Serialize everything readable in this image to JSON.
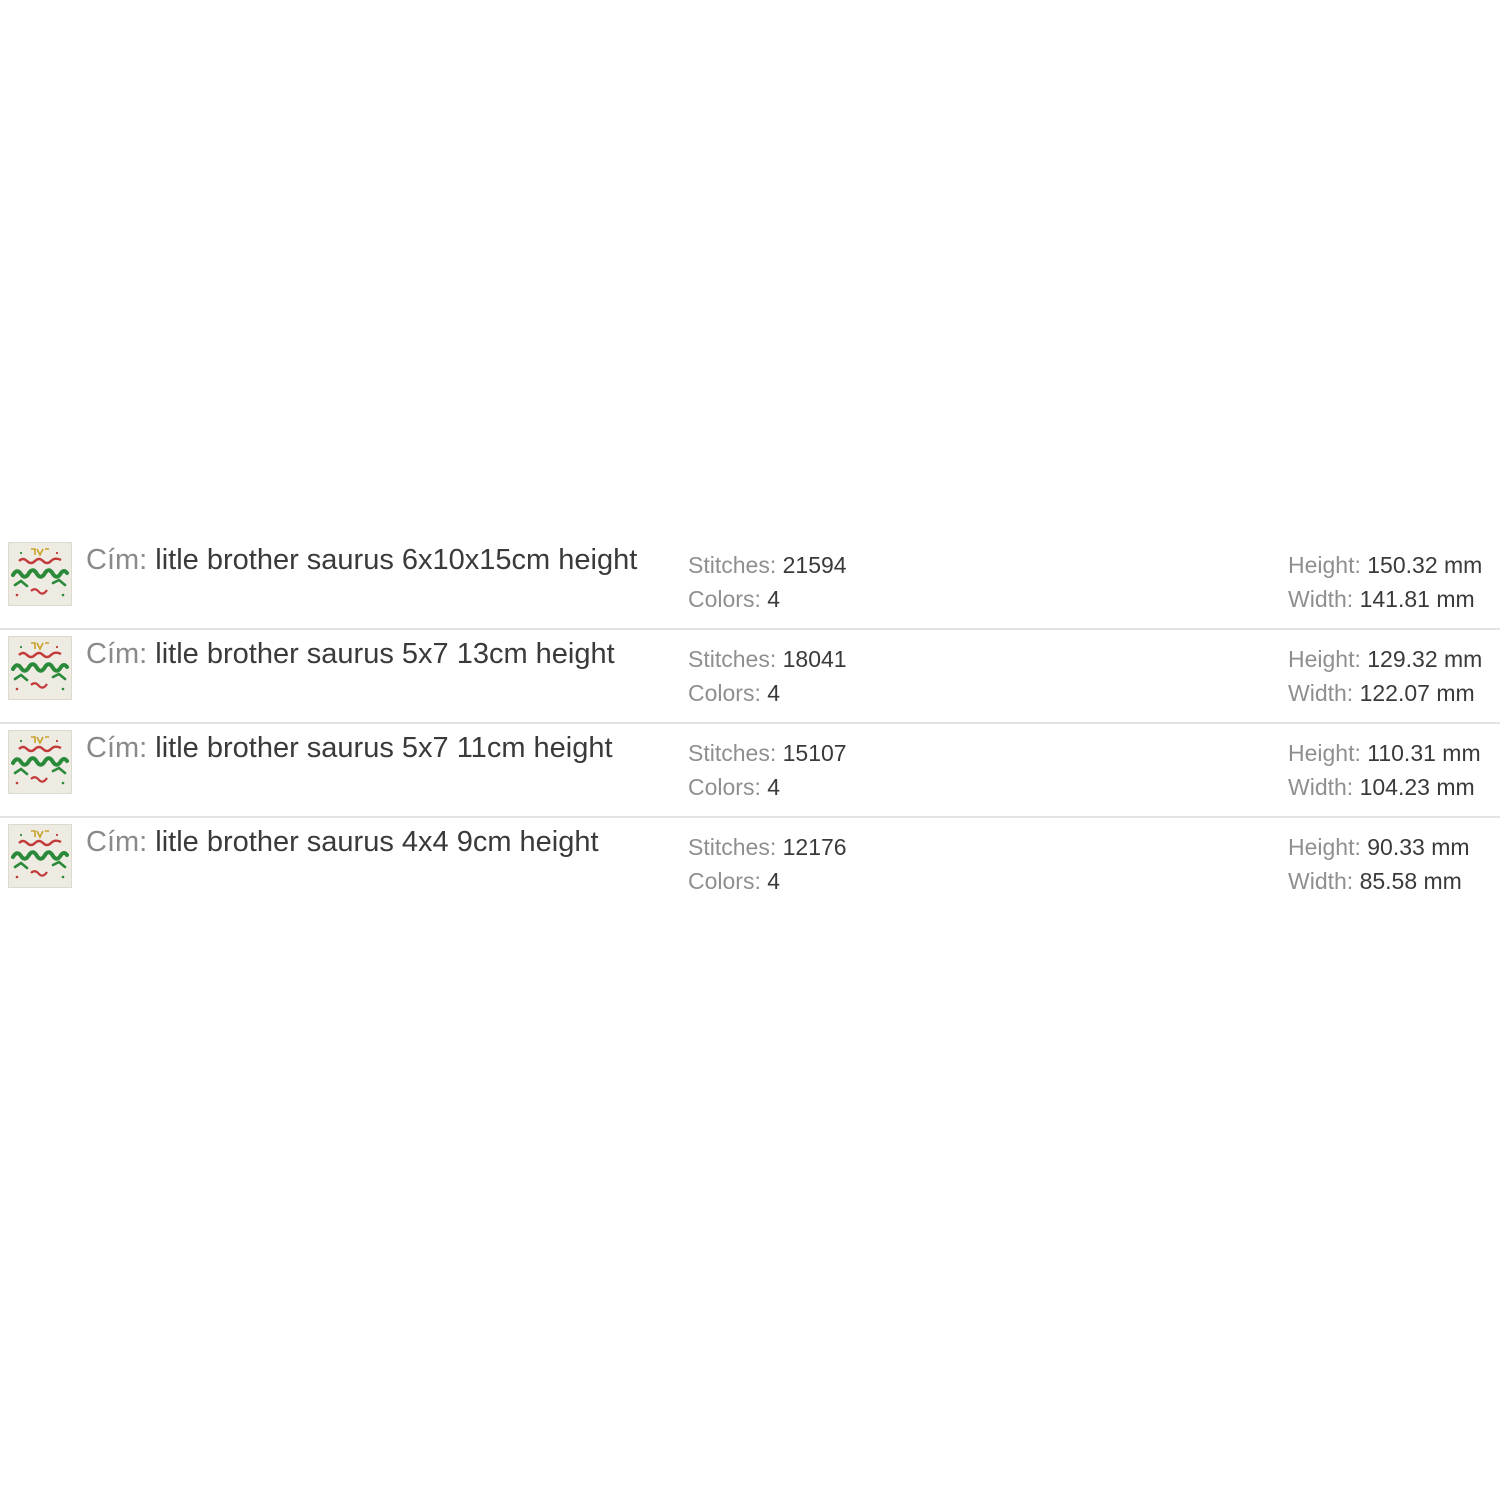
{
  "labels": {
    "title": "Cím:",
    "stitches": "Stitches:",
    "colors": "Colors:",
    "height": "Height:",
    "width": "Width:"
  },
  "thumbnail_icon": "little-brother-saurus-design-icon",
  "items": [
    {
      "name": "litle brother saurus 6x10x15cm height",
      "stitches": "21594",
      "colors": "4",
      "height": "150.32 mm",
      "width": "141.81 mm"
    },
    {
      "name": "litle brother saurus 5x7 13cm height",
      "stitches": "18041",
      "colors": "4",
      "height": "129.32 mm",
      "width": "122.07 mm"
    },
    {
      "name": "litle brother saurus 5x7 11cm height",
      "stitches": "15107",
      "colors": "4",
      "height": "110.31 mm",
      "width": "104.23 mm"
    },
    {
      "name": "litle brother saurus 4x4 9cm height",
      "stitches": "12176",
      "colors": "4",
      "height": "90.33 mm",
      "width": "85.58 mm"
    }
  ]
}
